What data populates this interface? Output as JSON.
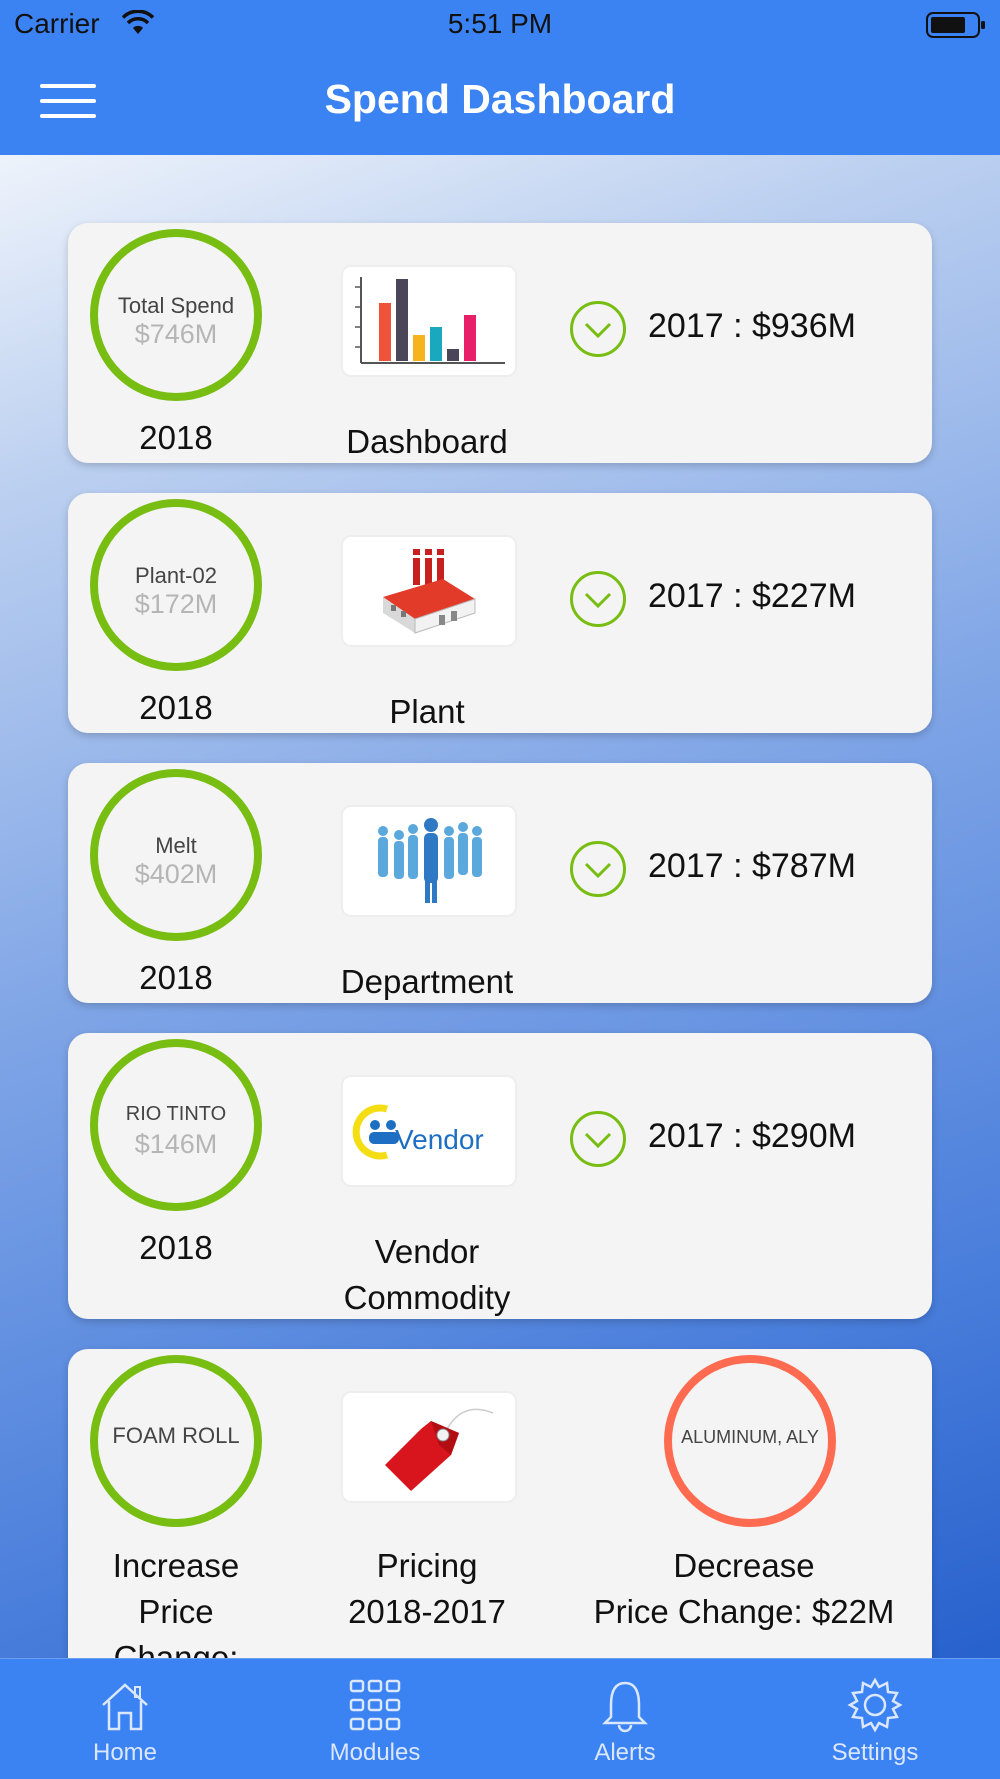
{
  "status_bar": {
    "carrier": "Carrier",
    "time": "5:51 PM"
  },
  "nav": {
    "title": "Spend Dashboard"
  },
  "cards": [
    {
      "ring_label": "Total Spend",
      "ring_value": "$746M",
      "year": "2018",
      "thumb_label": "Dashboard",
      "thumb_icon": "bar-chart-icon",
      "comparison": "2017 : $936M"
    },
    {
      "ring_label": "Plant-02",
      "ring_value": "$172M",
      "year": "2018",
      "thumb_label": "Plant",
      "thumb_icon": "factory-icon",
      "comparison": "2017 : $227M"
    },
    {
      "ring_label": "Melt",
      "ring_value": "$402M",
      "year": "2018",
      "thumb_label": "Department",
      "thumb_icon": "people-icon",
      "comparison": "2017 : $787M"
    },
    {
      "ring_label": "RIO TINTO",
      "ring_value": "$146M",
      "year": "2018",
      "thumb_label_line1": "Vendor",
      "thumb_label_line2": "Commodity",
      "thumb_icon": "vendor-logo-icon",
      "vendor_logo_text": "Vendor",
      "comparison": "2017 : $290M"
    },
    {
      "ring_label": "FOAM ROLL",
      "increase_line1": "Increase",
      "increase_line2": "Price",
      "increase_line3": "Change:",
      "thumb_icon": "price-tag-icon",
      "pricing_line1": "Pricing",
      "pricing_line2": "2018-2017",
      "red_ring_label": "ALUMINUM, ALY",
      "decrease_line1": "Decrease",
      "decrease_line2": "Price Change: $22M"
    }
  ],
  "tabs": [
    {
      "label": "Home",
      "icon": "home-icon"
    },
    {
      "label": "Modules",
      "icon": "grid-icon"
    },
    {
      "label": "Alerts",
      "icon": "bell-icon"
    },
    {
      "label": "Settings",
      "icon": "gear-icon"
    }
  ],
  "colors": {
    "primary": "#3b82f2",
    "ring_green": "#77bd12",
    "ring_red": "#ff6b50",
    "card_bg": "#f4f4f4"
  }
}
